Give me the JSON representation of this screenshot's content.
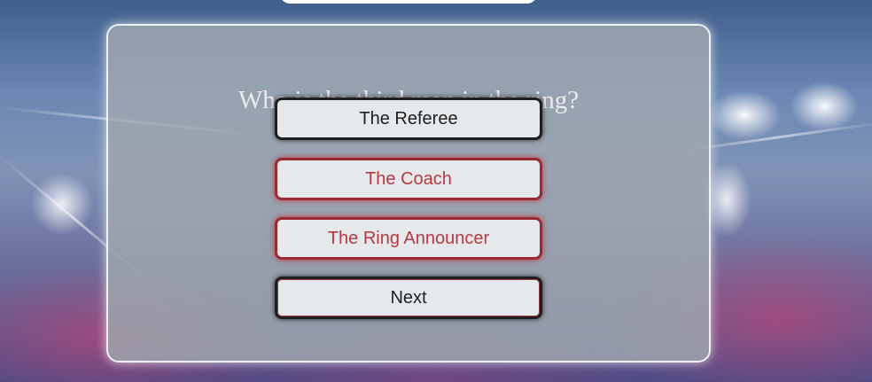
{
  "quiz": {
    "question": "Who is the third man in the ring?",
    "answers": [
      {
        "label": "The Referee",
        "state": "neutral"
      },
      {
        "label": "The Coach",
        "state": "wrong"
      },
      {
        "label": "The Ring Announcer",
        "state": "wrong"
      }
    ],
    "next_label": "Next"
  },
  "colors": {
    "wrong_accent": "#b8393f",
    "button_bg": "#e6e9ec",
    "card_bg": "#a0a8af"
  }
}
